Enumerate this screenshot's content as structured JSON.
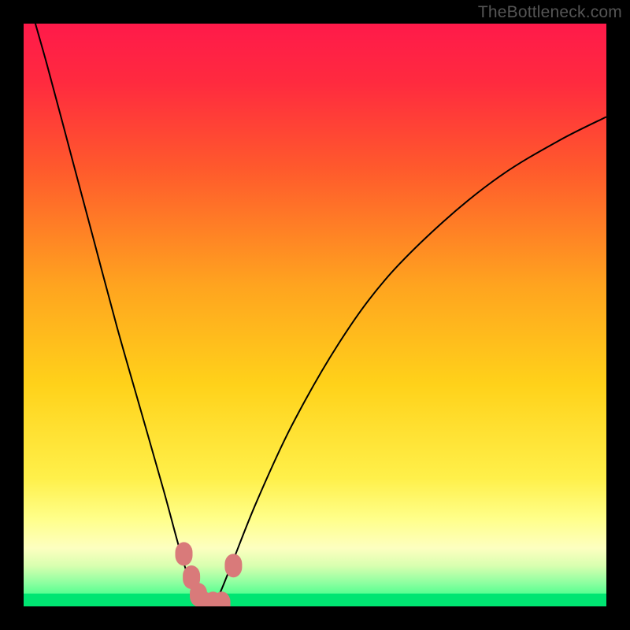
{
  "watermark": "TheBottleneck.com",
  "chart_data": {
    "type": "line",
    "title": "",
    "xlabel": "",
    "ylabel": "",
    "xlim": [
      0,
      100
    ],
    "ylim": [
      0,
      100
    ],
    "axes_visible": false,
    "grid": false,
    "background_gradient": {
      "stops": [
        {
          "offset": 0.0,
          "color": "#ff1a4a"
        },
        {
          "offset": 0.1,
          "color": "#ff2a3f"
        },
        {
          "offset": 0.25,
          "color": "#ff5a2c"
        },
        {
          "offset": 0.45,
          "color": "#ffa41f"
        },
        {
          "offset": 0.62,
          "color": "#ffd21a"
        },
        {
          "offset": 0.78,
          "color": "#fff04a"
        },
        {
          "offset": 0.85,
          "color": "#ffff8a"
        },
        {
          "offset": 0.9,
          "color": "#fdffc0"
        },
        {
          "offset": 0.93,
          "color": "#d9ffb0"
        },
        {
          "offset": 0.96,
          "color": "#8cffa0"
        },
        {
          "offset": 1.0,
          "color": "#1aff80"
        }
      ]
    },
    "curve": {
      "description": "V-shaped bottleneck curve; y is approximate mismatch %, minimum ~0 near x≈31",
      "x": [
        0,
        4,
        8,
        12,
        16,
        20,
        24,
        27,
        29,
        30,
        31,
        32,
        33,
        34,
        36,
        40,
        46,
        54,
        62,
        72,
        82,
        92,
        100
      ],
      "y": [
        107,
        93,
        78,
        63,
        48,
        34,
        20,
        9,
        3,
        1,
        0,
        0,
        1,
        3,
        8,
        18,
        31,
        45,
        56,
        66,
        74,
        80,
        84
      ]
    },
    "markers": {
      "description": "Rounded pink markers near the curve minimum",
      "color": "#d97a7a",
      "points": [
        {
          "x": 27.5,
          "y": 9
        },
        {
          "x": 28.8,
          "y": 5
        },
        {
          "x": 30.0,
          "y": 2
        },
        {
          "x": 31.0,
          "y": 0.5
        },
        {
          "x": 32.5,
          "y": 0.5
        },
        {
          "x": 34.0,
          "y": 0.5
        },
        {
          "x": 36.0,
          "y": 7
        }
      ]
    },
    "bottom_strip": {
      "color": "#00e572",
      "thickness_pct": 2.2
    }
  }
}
